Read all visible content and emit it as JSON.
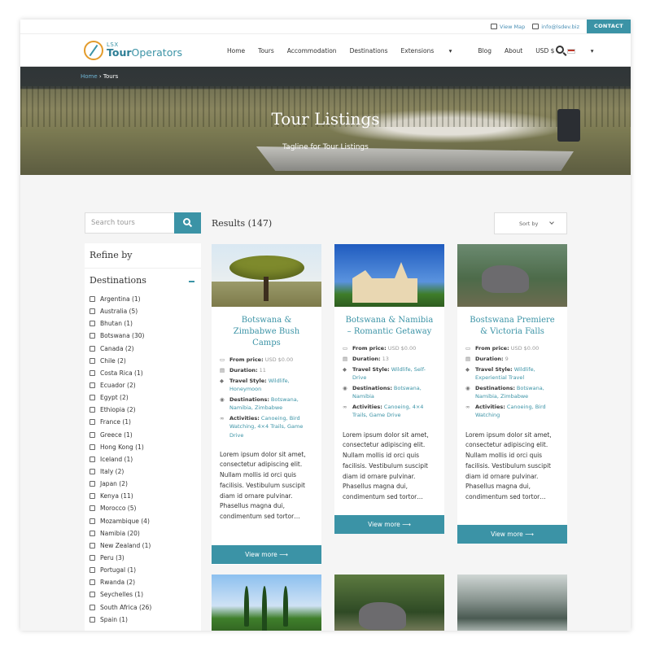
{
  "topbar": {
    "view_map": "View Map",
    "email": "info@lsdev.biz",
    "contact": "CONTACT"
  },
  "logo": {
    "small": "LSX",
    "big_a": "Tour",
    "big_b": "Operators"
  },
  "nav": {
    "items": [
      "Home",
      "Tours",
      "Accommodation",
      "Destinations",
      "Extensions",
      "Blog",
      "About"
    ],
    "currency": "USD $",
    "extensions_caret": "▾",
    "currency_caret": "▾"
  },
  "hero": {
    "breadcrumb_home": "Home",
    "breadcrumb_sep": " › ",
    "breadcrumb_current": "Tours",
    "title": "Tour Listings",
    "tagline": "Tagline for Tour Listings"
  },
  "search": {
    "placeholder": "Search tours"
  },
  "results": {
    "title": "Results (147)",
    "sort_label": "Sort by"
  },
  "sidebar": {
    "refine": "Refine by",
    "destinations_heading": "Destinations",
    "destinations": [
      "Argentina (1)",
      "Australia (5)",
      "Bhutan (1)",
      "Botswana (30)",
      "Canada (2)",
      "Chile (2)",
      "Costa Rica (1)",
      "Ecuador (2)",
      "Egypt (2)",
      "Ethiopia (2)",
      "France (1)",
      "Greece (1)",
      "Hong Kong (1)",
      "Iceland (1)",
      "Italy (2)",
      "Japan (2)",
      "Kenya (11)",
      "Morocco (5)",
      "Mozambique (4)",
      "Namibia (20)",
      "New Zealand (1)",
      "Peru (3)",
      "Portugal (1)",
      "Rwanda (2)",
      "Seychelles (1)",
      "South Africa (26)",
      "Spain (1)"
    ]
  },
  "cards": [
    {
      "title": "Botswana & Zimbabwe Bush Camps",
      "price_label": "From price:",
      "price": "USD $0.00",
      "duration_label": "Duration:",
      "duration": "11",
      "style_label": "Travel Style:",
      "style": "Wildlife, Honeymoon",
      "dest_label": "Destinations:",
      "dest": "Botswana, Namibia, Zimbabwe",
      "act_label": "Activities:",
      "act": "Canoeing, Bird Watching, 4×4 Trails, Game Drive",
      "excerpt": "Lorem ipsum dolor sit amet, consectetur adipiscing elit. Nullam mollis id orci quis facilisis. Vestibulum suscipit diam id ornare pulvinar. Phasellus magna dui, condimentum sed tortor…",
      "button": "View more ⟶"
    },
    {
      "title": "Botswana & Namibia – Romantic Getaway",
      "price_label": "From price:",
      "price": "USD $0.00",
      "duration_label": "Duration:",
      "duration": "13",
      "style_label": "Travel Style:",
      "style": "Wildlife, Self-Drive",
      "dest_label": "Destinations:",
      "dest": "Botswana, Namibia",
      "act_label": "Activities:",
      "act": "Canoeing, 4×4 Trails, Game Drive",
      "excerpt": "Lorem ipsum dolor sit amet, consectetur adipiscing elit. Nullam mollis id orci quis facilisis. Vestibulum suscipit diam id ornare pulvinar. Phasellus magna dui, condimentum sed tortor…",
      "button": "View more ⟶"
    },
    {
      "title": "Bostswana Premiere & Victoria Falls",
      "price_label": "From price:",
      "price": "USD $0.00",
      "duration_label": "Duration:",
      "duration": "9",
      "style_label": "Travel Style:",
      "style": "Wildlife, Experiential Travel",
      "dest_label": "Destinations:",
      "dest": "Botswana, Namibia, Zimbabwe",
      "act_label": "Activities:",
      "act": "Canoeing, Bird Watching",
      "excerpt": "Lorem ipsum dolor sit amet, consectetur adipiscing elit. Nullam mollis id orci quis facilisis. Vestibulum suscipit diam id ornare pulvinar. Phasellus magna dui, condimentum sed tortor…",
      "button": "View more ⟶"
    }
  ],
  "colors": {
    "accent": "#3b93a6",
    "logo_orange": "#e39b2b",
    "page_bg": "#f5f5f5"
  },
  "icons": {
    "price": "money-icon",
    "duration": "calendar-icon",
    "style": "tag-icon",
    "dest": "globe-icon",
    "act": "binoculars-icon"
  }
}
